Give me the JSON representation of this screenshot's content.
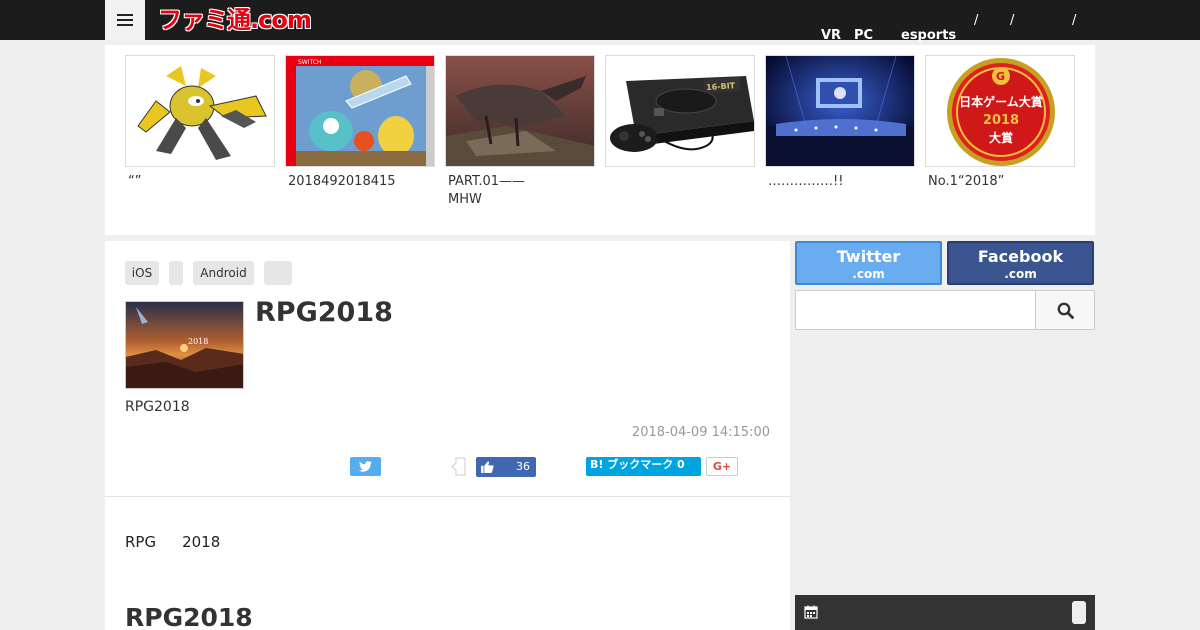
{
  "header": {
    "logo": "ファミ通.com",
    "nav": {
      "vr": "VR",
      "pc": "PC",
      "esports": "esports",
      "sep1": "/",
      "sep2": "/",
      "sep3": "/"
    }
  },
  "carousel": {
    "items": [
      {
        "caption": "“”",
        "image": "pokemon-character"
      },
      {
        "caption": "2018492018415",
        "image": "switch-game-cover"
      },
      {
        "caption": "PART.01——\nMHW",
        "image": "monster-hunter-scene"
      },
      {
        "caption": "",
        "image": "mega-drive-console"
      },
      {
        "caption": "……………!!",
        "image": "orchestra-concert"
      },
      {
        "caption": "No.1“2018”",
        "image": "japan-game-awards-2018"
      }
    ],
    "award_text": "日本ゲーム大賞",
    "award_year": "2018",
    "award_grand": "大賞",
    "console_badge": "16-BIT",
    "switch_label": "SWITCH"
  },
  "article": {
    "tags": [
      "iOS",
      "",
      "Android",
      ""
    ],
    "title": "RPG2018",
    "subtitle": "RPG2018",
    "date": "2018-04-09 14:15:00",
    "like_count": "36",
    "hatena_label": "B! ブックマーク 0",
    "gplus_label": "G+",
    "body_words": [
      "RPG",
      "2018"
    ],
    "heading2": "RPG2018",
    "thumb_text": "2018"
  },
  "sidebar": {
    "twitter": {
      "name": "Twitter",
      "domain": ".com",
      "color": "#6aacf0"
    },
    "facebook": {
      "name": "Facebook",
      "domain": ".com",
      "color": "#3b5591"
    },
    "search": {
      "placeholder": ""
    }
  }
}
